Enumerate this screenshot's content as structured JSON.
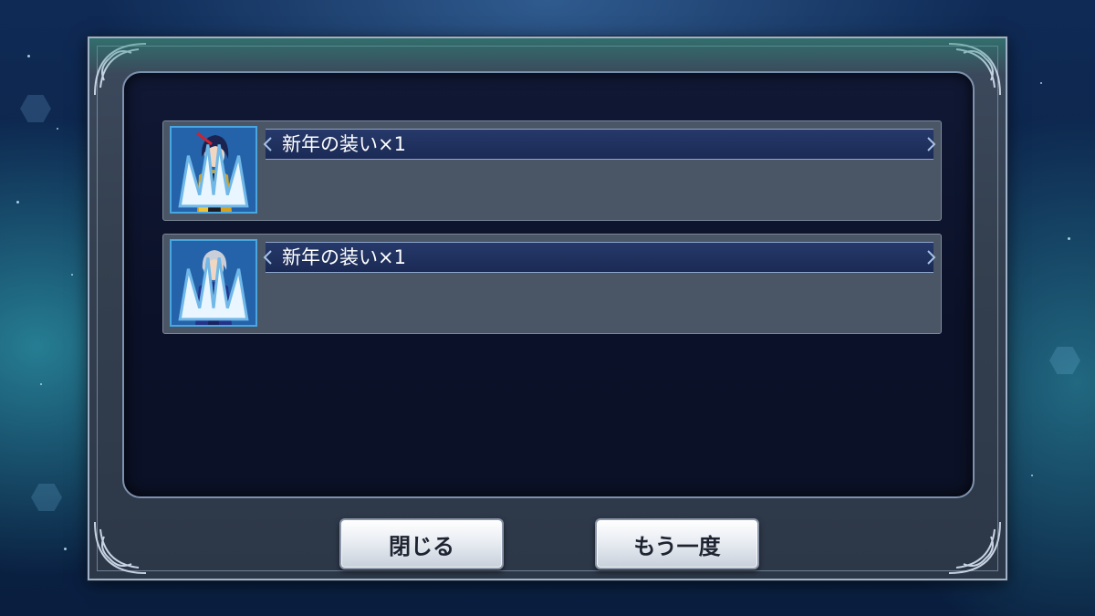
{
  "rewards": [
    {
      "character": "black-haired-samurai",
      "label": "新年の装い×1"
    },
    {
      "character": "silver-haired-samurai",
      "label": "新年の装い×1"
    }
  ],
  "buttons": {
    "close_label": "閉じる",
    "again_label": "もう一度"
  }
}
